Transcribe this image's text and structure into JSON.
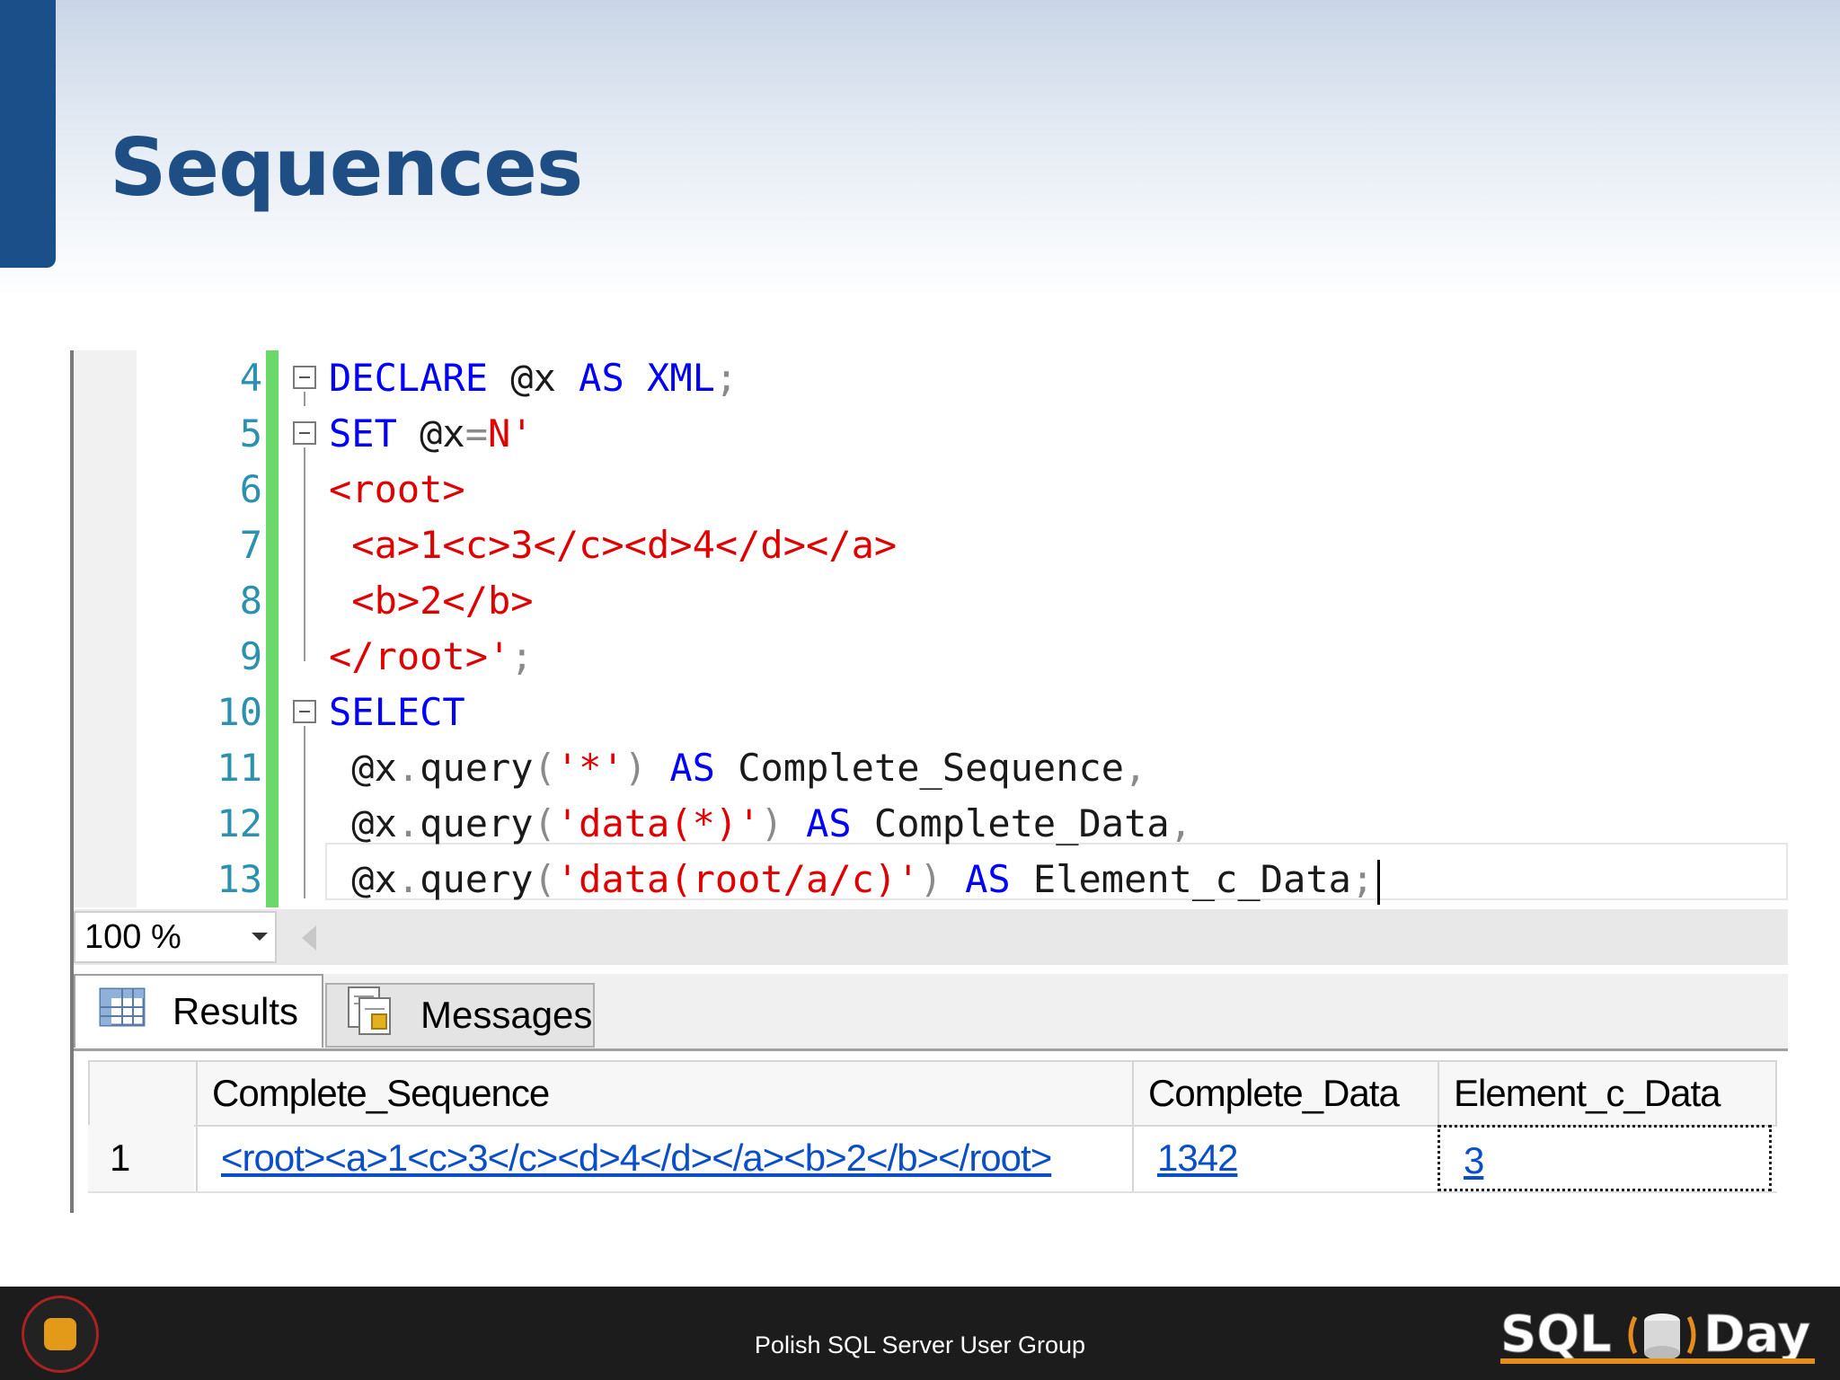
{
  "slide": {
    "title": "Sequences"
  },
  "editor": {
    "lines": [
      {
        "num": "4",
        "tokens": [
          {
            "t": "DECLARE",
            "c": "kw"
          },
          {
            "t": " @x ",
            "c": "var"
          },
          {
            "t": "AS",
            "c": "kw"
          },
          {
            "t": " ",
            "c": "var"
          },
          {
            "t": "XML",
            "c": "kw"
          },
          {
            "t": ";",
            "c": "op"
          }
        ]
      },
      {
        "num": "5",
        "tokens": [
          {
            "t": "SET",
            "c": "kw"
          },
          {
            "t": " @x",
            "c": "var"
          },
          {
            "t": "=",
            "c": "op"
          },
          {
            "t": "N'",
            "c": "str"
          }
        ]
      },
      {
        "num": "6",
        "tokens": [
          {
            "t": "<root>",
            "c": "str"
          }
        ]
      },
      {
        "num": "7",
        "tokens": [
          {
            "t": " <a>1<c>3</c><d>4</d></a>",
            "c": "str"
          }
        ]
      },
      {
        "num": "8",
        "tokens": [
          {
            "t": " <b>2</b>",
            "c": "str"
          }
        ]
      },
      {
        "num": "9",
        "tokens": [
          {
            "t": "</root>'",
            "c": "str"
          },
          {
            "t": ";",
            "c": "op"
          }
        ]
      },
      {
        "num": "10",
        "tokens": [
          {
            "t": "SELECT",
            "c": "kw"
          }
        ]
      },
      {
        "num": "11",
        "tokens": [
          {
            "t": " @x",
            "c": "var"
          },
          {
            "t": ".",
            "c": "op"
          },
          {
            "t": "query",
            "c": "fn"
          },
          {
            "t": "(",
            "c": "op"
          },
          {
            "t": "'*'",
            "c": "str"
          },
          {
            "t": ")",
            "c": "op"
          },
          {
            "t": " ",
            "c": "var"
          },
          {
            "t": "AS",
            "c": "kw"
          },
          {
            "t": " Complete_Sequence",
            "c": "var"
          },
          {
            "t": ",",
            "c": "op"
          }
        ]
      },
      {
        "num": "12",
        "tokens": [
          {
            "t": " @x",
            "c": "var"
          },
          {
            "t": ".",
            "c": "op"
          },
          {
            "t": "query",
            "c": "fn"
          },
          {
            "t": "(",
            "c": "op"
          },
          {
            "t": "'data(*)'",
            "c": "str"
          },
          {
            "t": ")",
            "c": "op"
          },
          {
            "t": " ",
            "c": "var"
          },
          {
            "t": "AS",
            "c": "kw"
          },
          {
            "t": " Complete_Data",
            "c": "var"
          },
          {
            "t": ",",
            "c": "op"
          }
        ]
      },
      {
        "num": "13",
        "tokens": [
          {
            "t": " @x",
            "c": "var"
          },
          {
            "t": ".",
            "c": "op"
          },
          {
            "t": "query",
            "c": "fn"
          },
          {
            "t": "(",
            "c": "op"
          },
          {
            "t": "'data(root/a/c)'",
            "c": "str"
          },
          {
            "t": ")",
            "c": "op"
          },
          {
            "t": " ",
            "c": "var"
          },
          {
            "t": "AS",
            "c": "kw"
          },
          {
            "t": " Element_c_Data",
            "c": "var"
          },
          {
            "t": ";",
            "c": "op"
          }
        ]
      }
    ]
  },
  "zoom": {
    "value": "100 %"
  },
  "tabs": {
    "results": "Results",
    "messages": "Messages"
  },
  "grid": {
    "headers": [
      "Complete_Sequence",
      "Complete_Data",
      "Element_c_Data"
    ],
    "rows": [
      {
        "num": "1",
        "cells": [
          "<root><a>1<c>3</c><d>4</d></a><b>2</b></root>",
          "1342",
          "3"
        ]
      }
    ]
  },
  "footer": {
    "text": "Polish SQL Server User Group"
  },
  "colors": {
    "keyword": "#0000ff",
    "string": "#e00000",
    "line_number": "#2b91af",
    "title": "#1f4e85",
    "change_bar": "#6ad96a"
  }
}
